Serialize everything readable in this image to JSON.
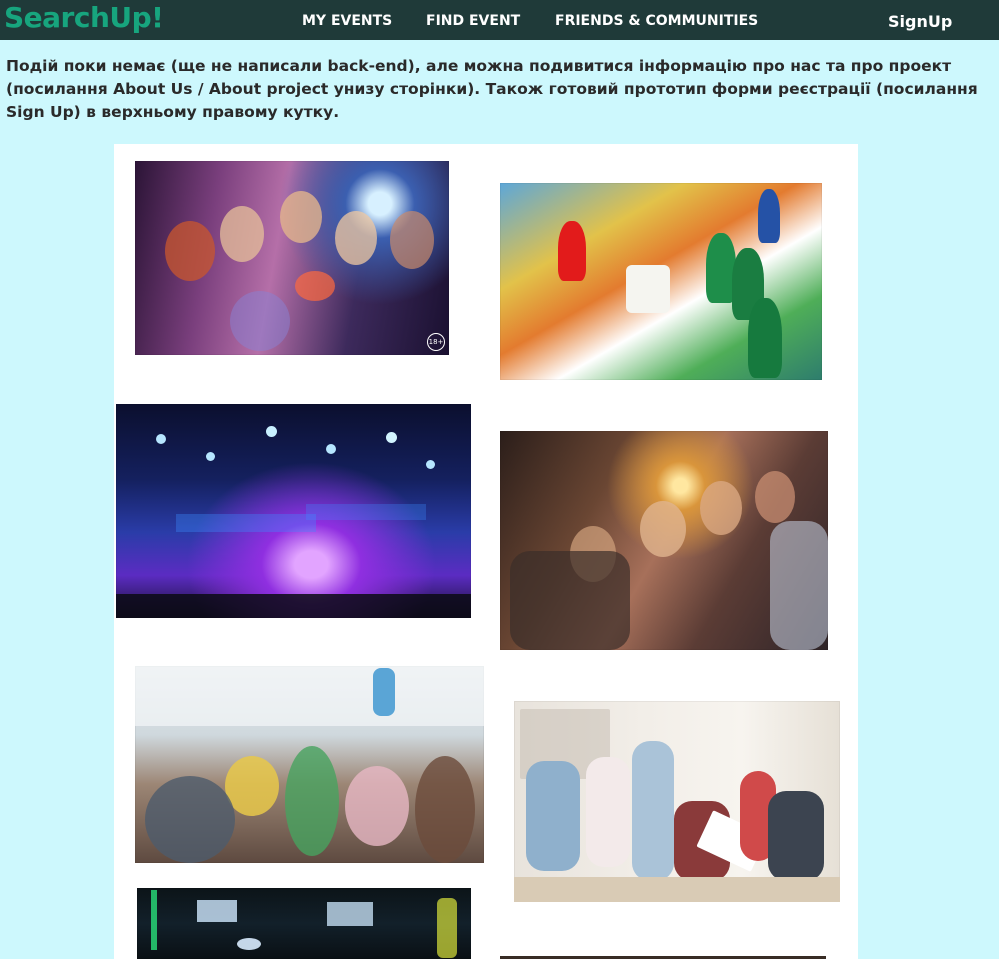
{
  "header": {
    "logo": "SearchUp!",
    "nav": [
      "MY EVENTS",
      "FIND EVENT",
      "FRIENDS & COMMUNITIES"
    ],
    "signup_label": "SignUp",
    "background_color": "#1f3a39",
    "logo_color": "#17a57e"
  },
  "notice": {
    "text": "Подій поки немає (ще не написали back-end), але можна подивитися інформацію про нас та про проект (посилання About Us / About project унизу сторінки). Також готовий прототип форми реєстрації (посилання Sign Up) в верхньому правому кутку."
  },
  "gallery": {
    "photos": [
      {
        "name": "party-friends-photo",
        "subject": "friends in party hats with cocktails",
        "badge": "18+"
      },
      {
        "name": "board-game-photo",
        "subject": "board game with dice and pawns"
      },
      {
        "name": "concert-photo",
        "subject": "concert stage with blue lights"
      },
      {
        "name": "celebration-photo",
        "subject": "friends celebrating with sparklers"
      },
      {
        "name": "seminar-photo",
        "subject": "audience at a seminar"
      },
      {
        "name": "meeting-photo",
        "subject": "team meeting around a flipchart"
      },
      {
        "name": "neon-room-photo",
        "subject": "room with neon lights"
      },
      {
        "name": "partial-photo",
        "subject": "partially visible photo"
      }
    ]
  },
  "page": {
    "background_color": "#cdf8fd"
  }
}
